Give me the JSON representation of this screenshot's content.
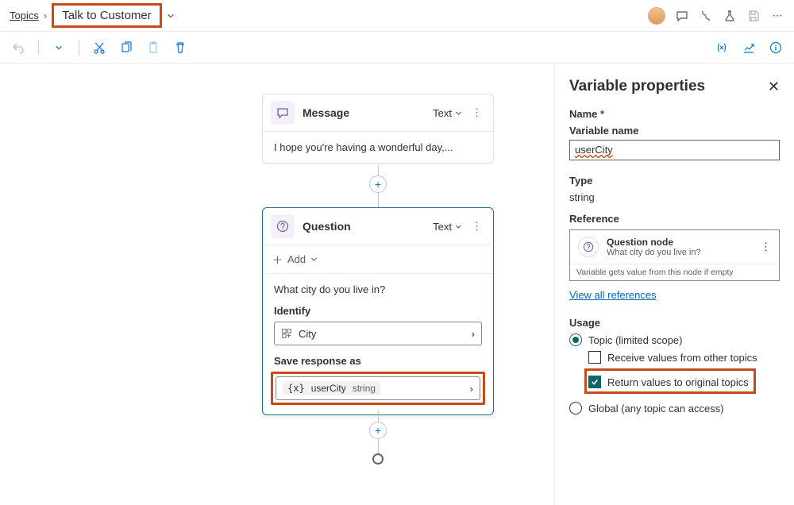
{
  "breadcrumb": {
    "root": "Topics",
    "current": "Talk to Customer"
  },
  "canvas": {
    "message_node": {
      "title": "Message",
      "type_label": "Text",
      "body": "I hope you're having a wonderful day,..."
    },
    "question_node": {
      "title": "Question",
      "type_label": "Text",
      "add_label": "Add",
      "prompt": "What city do you live in?",
      "identify_label": "Identify",
      "identify_value": "City",
      "save_label": "Save response as",
      "var_name": "userCity",
      "var_type": "string"
    }
  },
  "panel": {
    "title": "Variable properties",
    "name_label": "Name",
    "name_sub": "Variable name",
    "name_value": "userCity",
    "type_label": "Type",
    "type_value": "string",
    "ref_label": "Reference",
    "ref_title": "Question node",
    "ref_sub": "What city do you live in?",
    "ref_note": "Variable gets value from this node if empty",
    "view_all": "View all references",
    "usage_label": "Usage",
    "usage_topic": "Topic (limited scope)",
    "usage_receive": "Receive values from other topics",
    "usage_return": "Return values to original topics",
    "usage_global": "Global (any topic can access)"
  }
}
